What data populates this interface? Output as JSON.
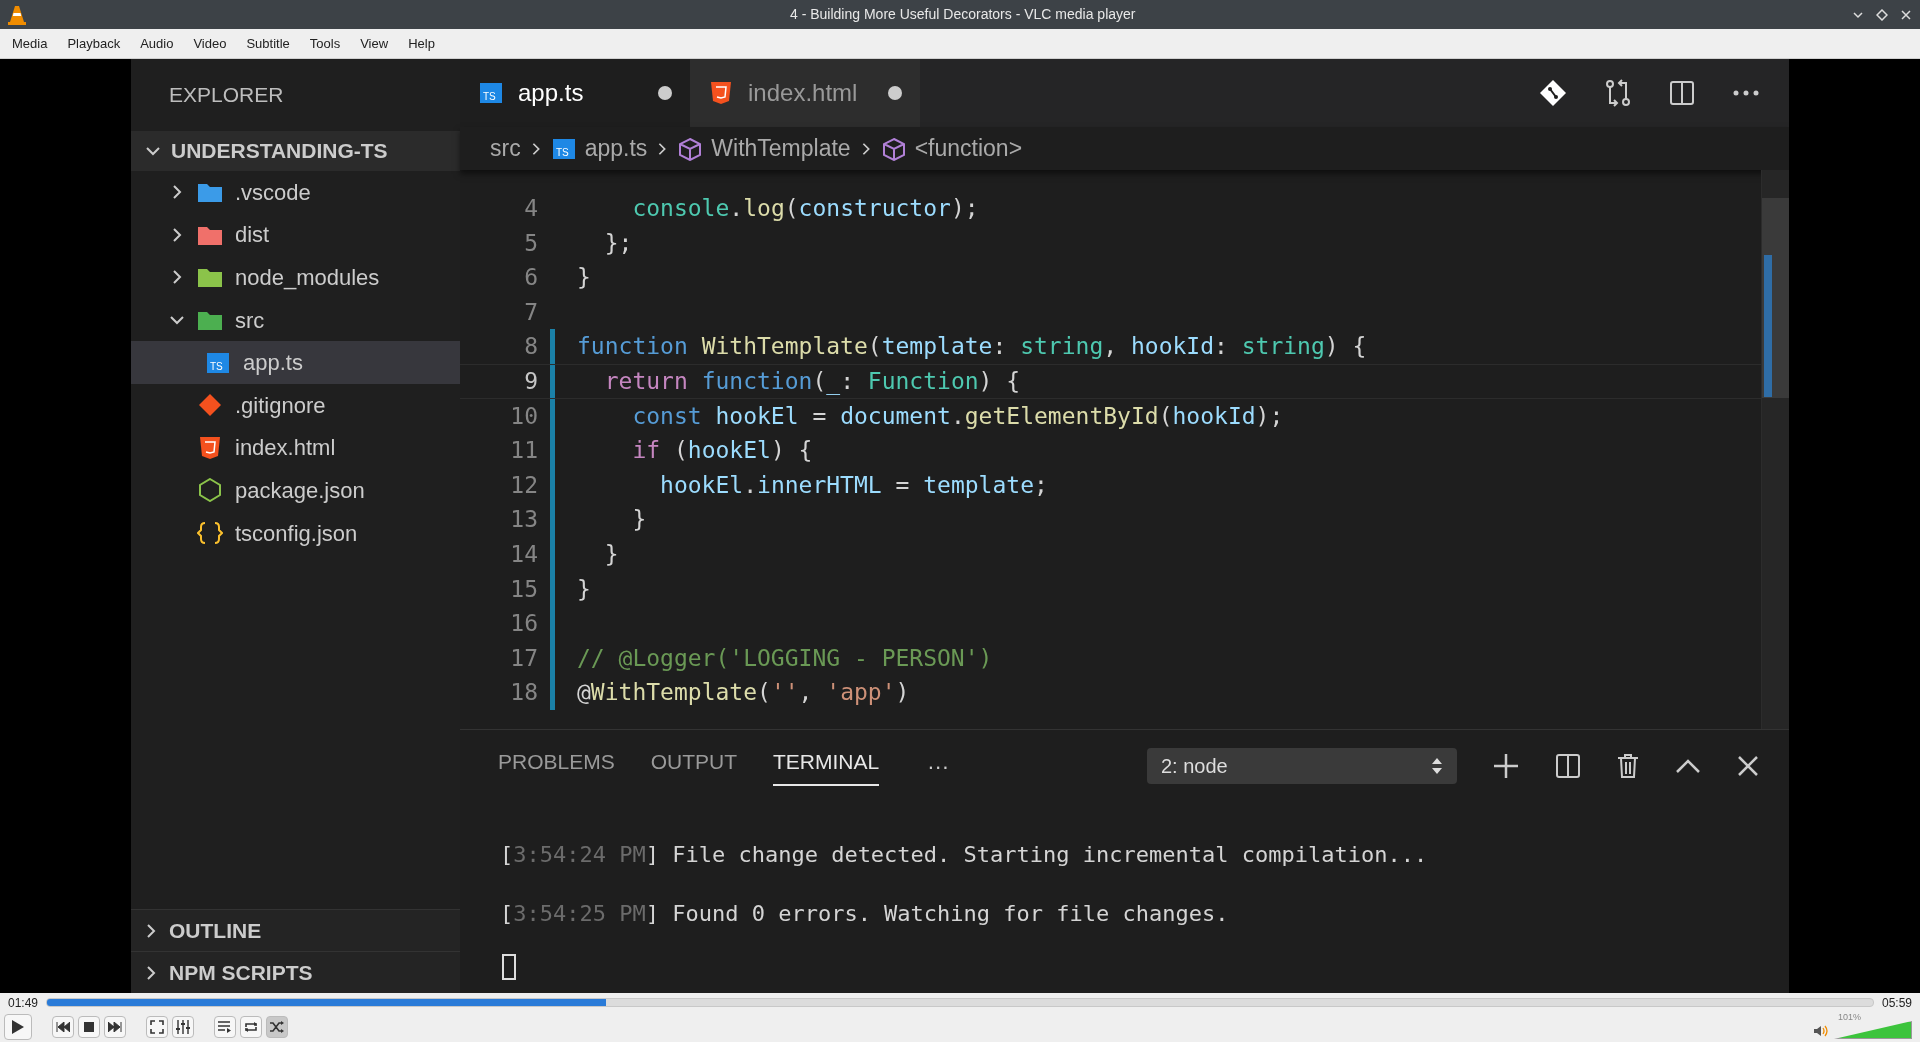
{
  "window": {
    "title": "4 - Building More Useful Decorators - VLC media player"
  },
  "menu": [
    "Media",
    "Playback",
    "Audio",
    "Video",
    "Subtitle",
    "Tools",
    "View",
    "Help"
  ],
  "video": {
    "explorer": {
      "title": "EXPLORER",
      "root": {
        "label": "UNDERSTANDING-TS",
        "expanded": true,
        "children": [
          {
            "label": ".vscode",
            "kind": "folder",
            "color": "#3b9be8",
            "expanded": false,
            "selected": false
          },
          {
            "label": "dist",
            "kind": "folder",
            "color": "#f0706a",
            "expanded": false,
            "selected": false
          },
          {
            "label": "node_modules",
            "kind": "folder",
            "color": "#8bc34a",
            "expanded": false,
            "selected": false
          },
          {
            "label": "src",
            "kind": "folder",
            "color": "#4caf50",
            "expanded": true,
            "selected": false,
            "children": [
              {
                "label": "app.ts",
                "kind": "ts",
                "badge": "TS",
                "color": "#1e88e5",
                "selected": true
              }
            ]
          },
          {
            "label": ".gitignore",
            "kind": "git",
            "color": "#f4511e",
            "selected": false
          },
          {
            "label": "index.html",
            "kind": "html",
            "color": "#f4511e",
            "selected": false
          },
          {
            "label": "package.json",
            "kind": "npm",
            "color": "#8bc34a",
            "selected": false
          },
          {
            "label": "tsconfig.json",
            "kind": "json",
            "color": "#fbc02d",
            "selected": false
          }
        ]
      },
      "sections": [
        {
          "label": "OUTLINE",
          "expanded": false
        },
        {
          "label": "NPM SCRIPTS",
          "expanded": false
        }
      ]
    },
    "tabs": [
      {
        "label": "app.ts",
        "kind": "ts",
        "badge": "TS",
        "selected": true,
        "dirty": true
      },
      {
        "label": "index.html",
        "kind": "html",
        "selected": false,
        "dirty": true
      }
    ],
    "breadcrumb": [
      {
        "label": "src",
        "kind": "folder"
      },
      {
        "label": "app.ts",
        "kind": "ts",
        "badge": "TS"
      },
      {
        "label": "WithTemplate",
        "kind": "symbol"
      },
      {
        "label": "<function>",
        "kind": "symbol"
      }
    ],
    "code": [
      {
        "number": "4",
        "modified": false,
        "current": false,
        "tokens": [
          {
            "text": "    console",
            "kind": "type"
          },
          {
            "text": ".",
            "kind": "plain"
          },
          {
            "text": "log",
            "kind": "fn"
          },
          {
            "text": "(",
            "kind": "plain"
          },
          {
            "text": "constructor",
            "kind": "var"
          },
          {
            "text": ");",
            "kind": "plain"
          }
        ]
      },
      {
        "number": "5",
        "modified": false,
        "current": false,
        "tokens": [
          {
            "text": "  };",
            "kind": "plain"
          }
        ]
      },
      {
        "number": "6",
        "modified": false,
        "current": false,
        "tokens": [
          {
            "text": "}",
            "kind": "plain"
          }
        ]
      },
      {
        "number": "7",
        "modified": false,
        "current": false
      },
      {
        "number": "8",
        "modified": true,
        "current": false,
        "tokens": [
          {
            "text": "function ",
            "kind": "kw"
          },
          {
            "text": "WithTemplate",
            "kind": "fn"
          },
          {
            "text": "(",
            "kind": "plain"
          },
          {
            "text": "template",
            "kind": "var"
          },
          {
            "text": ": ",
            "kind": "plain"
          },
          {
            "text": "string",
            "kind": "type"
          },
          {
            "text": ", ",
            "kind": "plain"
          },
          {
            "text": "hookId",
            "kind": "var"
          },
          {
            "text": ": ",
            "kind": "plain"
          },
          {
            "text": "string",
            "kind": "type"
          },
          {
            "text": ") {",
            "kind": "plain"
          }
        ]
      },
      {
        "number": "9",
        "modified": true,
        "current": true,
        "tokens": [
          {
            "text": "  return ",
            "kind": "ctrl"
          },
          {
            "text": "function",
            "kind": "kw"
          },
          {
            "text": "(",
            "kind": "plain"
          },
          {
            "text": "_",
            "kind": "var"
          },
          {
            "text": ": ",
            "kind": "plain"
          },
          {
            "text": "Function",
            "kind": "type"
          },
          {
            "text": ") {",
            "kind": "plain"
          }
        ]
      },
      {
        "number": "10",
        "modified": true,
        "current": false,
        "tokens": [
          {
            "text": "    const ",
            "kind": "kw"
          },
          {
            "text": "hookEl",
            "kind": "var"
          },
          {
            "text": " = ",
            "kind": "plain"
          },
          {
            "text": "document",
            "kind": "var"
          },
          {
            "text": ".",
            "kind": "plain"
          },
          {
            "text": "getElementById",
            "kind": "fn"
          },
          {
            "text": "(",
            "kind": "plain"
          },
          {
            "text": "hookId",
            "kind": "var"
          },
          {
            "text": ");",
            "kind": "plain"
          }
        ]
      },
      {
        "number": "11",
        "modified": true,
        "current": false,
        "tokens": [
          {
            "text": "    if",
            "kind": "ctrl"
          },
          {
            "text": " (",
            "kind": "plain"
          },
          {
            "text": "hookEl",
            "kind": "var"
          },
          {
            "text": ") {",
            "kind": "plain"
          }
        ]
      },
      {
        "number": "12",
        "modified": true,
        "current": false,
        "tokens": [
          {
            "text": "      hookEl",
            "kind": "var"
          },
          {
            "text": ".",
            "kind": "plain"
          },
          {
            "text": "innerHTML",
            "kind": "var"
          },
          {
            "text": " = ",
            "kind": "plain"
          },
          {
            "text": "template",
            "kind": "var"
          },
          {
            "text": ";",
            "kind": "plain"
          }
        ]
      },
      {
        "number": "13",
        "modified": true,
        "current": false,
        "tokens": [
          {
            "text": "    }",
            "kind": "plain"
          }
        ]
      },
      {
        "number": "14",
        "modified": true,
        "current": false,
        "tokens": [
          {
            "text": "  }",
            "kind": "plain"
          }
        ]
      },
      {
        "number": "15",
        "modified": true,
        "current": false,
        "tokens": [
          {
            "text": "}",
            "kind": "plain"
          }
        ]
      },
      {
        "number": "16",
        "modified": true,
        "current": false
      },
      {
        "number": "17",
        "modified": true,
        "current": false,
        "tokens": [
          {
            "text": "// @Logger('LOGGING - PERSON')",
            "kind": "cmt"
          }
        ]
      },
      {
        "number": "18",
        "modified": true,
        "current": false,
        "tokens": [
          {
            "text": "@",
            "kind": "plain"
          },
          {
            "text": "WithTemplate",
            "kind": "fn"
          },
          {
            "text": "(",
            "kind": "plain"
          },
          {
            "text": "''",
            "kind": "str"
          },
          {
            "text": ", ",
            "kind": "plain"
          },
          {
            "text": "'app'",
            "kind": "str"
          },
          {
            "text": ")",
            "kind": "plain"
          }
        ]
      }
    ],
    "panel": {
      "tabs": [
        {
          "label": "PROBLEMS",
          "selected": false
        },
        {
          "label": "OUTPUT",
          "selected": false
        },
        {
          "label": "TERMINAL",
          "selected": true
        }
      ],
      "more": "···",
      "terminal_select": "2: node",
      "lines": [
        [
          {
            "text": "[",
            "kind": "plain"
          },
          {
            "text": "3:54:24 PM",
            "kind": "dim"
          },
          {
            "text": "] File change detected. Starting incremental compilation...",
            "kind": "plain"
          }
        ],
        [
          {
            "text": "[",
            "kind": "plain"
          },
          {
            "text": "3:54:25 PM",
            "kind": "dim"
          },
          {
            "text": "] Found 0 errors. Watching for file changes.",
            "kind": "plain"
          }
        ]
      ]
    }
  },
  "player": {
    "elapsed": "01:49",
    "total": "05:59",
    "seek": {
      "level": 0.306
    },
    "loop": false,
    "random": true,
    "volume": {
      "reading": "101%",
      "level": 1.0
    }
  }
}
